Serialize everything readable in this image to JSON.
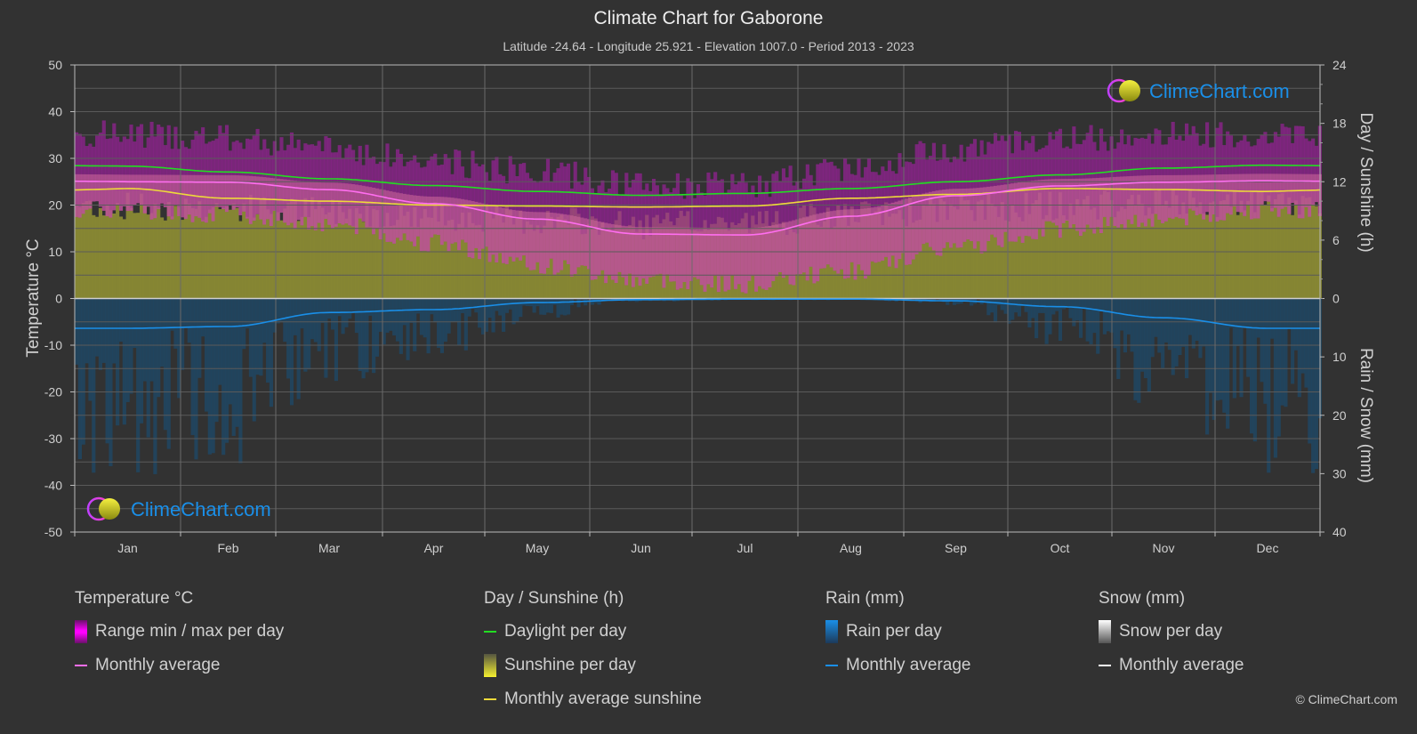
{
  "chart_data": {
    "type": "line",
    "title": "Climate Chart for Gaborone",
    "subtitle": "Latitude -24.64 - Longitude 25.921 - Elevation 1007.0 - Period 2013 - 2023",
    "categories": [
      "Jan",
      "Feb",
      "Mar",
      "Apr",
      "May",
      "Jun",
      "Jul",
      "Aug",
      "Sep",
      "Oct",
      "Nov",
      "Dec"
    ],
    "axes": {
      "left": {
        "label": "Temperature °C",
        "range": [
          -50,
          50
        ],
        "ticks": [
          50,
          40,
          30,
          20,
          10,
          0,
          -10,
          -20,
          -30,
          -40,
          -50
        ]
      },
      "right_top": {
        "label": "Day / Sunshine (h)",
        "range": [
          0,
          24
        ],
        "ticks": [
          24,
          18,
          12,
          6,
          0
        ]
      },
      "right_bottom": {
        "label": "Rain / Snow (mm)",
        "range": [
          0,
          40
        ],
        "ticks": [
          0,
          10,
          20,
          30,
          40
        ]
      }
    },
    "grid": true,
    "series": [
      {
        "name": "Daylight per day",
        "axis": "hours",
        "color": "#22dd22",
        "values": [
          13.6,
          13.0,
          12.3,
          11.6,
          11.0,
          10.6,
          10.8,
          11.3,
          12.0,
          12.7,
          13.4,
          13.7
        ]
      },
      {
        "name": "Monthly average sunshine",
        "axis": "hours",
        "color": "#eeda3a",
        "values": [
          11.3,
          10.3,
          10.0,
          9.6,
          9.5,
          9.4,
          9.5,
          10.3,
          10.7,
          11.3,
          11.2,
          11.0
        ]
      },
      {
        "name": "Temperature monthly average",
        "axis": "temperature",
        "color": "#ff6ef0",
        "values": [
          25.0,
          24.9,
          23.3,
          20.3,
          17.0,
          13.8,
          13.6,
          17.6,
          22.0,
          24.1,
          24.9,
          25.2
        ]
      },
      {
        "name": "Rain monthly average",
        "axis": "rain",
        "color": "#1a8fe8",
        "values": [
          5.1,
          4.8,
          2.4,
          1.9,
          0.7,
          0.2,
          0.1,
          0.1,
          0.4,
          1.4,
          3.3,
          5.1
        ]
      },
      {
        "name": "Temperature max per day (approx. band top)",
        "axis": "temperature",
        "values": [
          34,
          33,
          31,
          28,
          26,
          23,
          23,
          27,
          31,
          33,
          34,
          34
        ]
      },
      {
        "name": "Temperature min per day (approx. band bottom)",
        "axis": "temperature",
        "values": [
          19,
          18,
          16,
          12,
          7,
          4,
          3,
          6,
          11,
          15,
          17,
          19
        ]
      },
      {
        "name": "Sunshine per day (approx.)",
        "axis": "hours",
        "values": [
          9.5,
          9.3,
          9.0,
          8.5,
          8.0,
          7.5,
          7.8,
          8.5,
          9.2,
          9.5,
          9.8,
          9.6
        ]
      }
    ]
  },
  "legend": {
    "groups": [
      {
        "title": "Temperature °C",
        "items": [
          {
            "label": "Range min / max per day",
            "kind": "box",
            "color": "#ff00ff"
          },
          {
            "label": "Monthly average",
            "kind": "line",
            "color": "#ff6ef0"
          }
        ]
      },
      {
        "title": "Day / Sunshine (h)",
        "items": [
          {
            "label": "Daylight per day",
            "kind": "line",
            "color": "#22dd22"
          },
          {
            "label": "Sunshine per day",
            "kind": "box",
            "color": "#f0f030"
          },
          {
            "label": "Monthly average sunshine",
            "kind": "line",
            "color": "#eeda3a"
          }
        ]
      },
      {
        "title": "Rain (mm)",
        "items": [
          {
            "label": "Rain per day",
            "kind": "box",
            "color": "#1a8fe8"
          },
          {
            "label": "Monthly average",
            "kind": "line",
            "color": "#1a8fe8"
          }
        ]
      },
      {
        "title": "Snow (mm)",
        "items": [
          {
            "label": "Snow per day",
            "kind": "box",
            "color": "#ffffff"
          },
          {
            "label": "Monthly average",
            "kind": "line",
            "color": "#ffffff"
          }
        ]
      }
    ]
  },
  "watermark": "ClimeChart.com",
  "copyright": "© ClimeChart.com"
}
